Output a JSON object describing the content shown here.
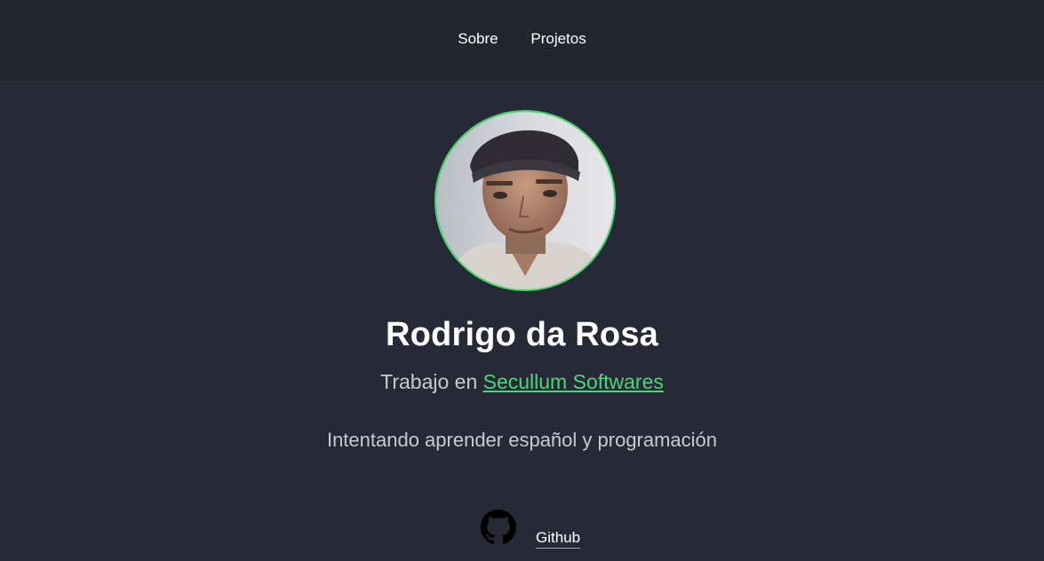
{
  "nav": {
    "items": [
      {
        "label": "Sobre"
      },
      {
        "label": "Projetos"
      }
    ]
  },
  "profile": {
    "name": "Rodrigo da Rosa",
    "job_prefix": "Trabajo en",
    "company": "Secullum Softwares",
    "bio": "Intentando aprender español y programación"
  },
  "social": {
    "github_label": "Github",
    "github_icon": "github-icon"
  },
  "colors": {
    "background": "#272a36",
    "topbar": "#23262f",
    "accent": "#3ddc6a",
    "text": "#ffffff",
    "muted_text": "#c9cad0"
  }
}
